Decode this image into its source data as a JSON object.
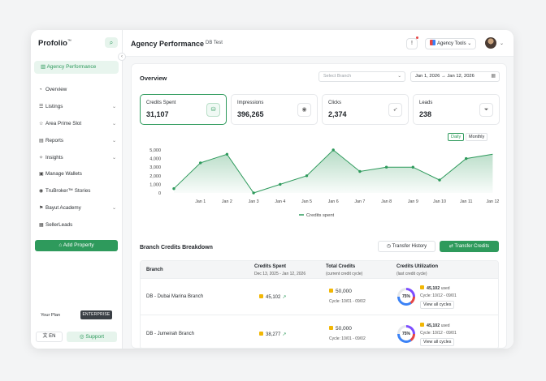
{
  "sidebar": {
    "logo": "Profolio",
    "logo_tm": "™",
    "active_item": "Agency Performance",
    "items": [
      {
        "label": "Overview",
        "icon": "pie-icon",
        "chevron": false
      },
      {
        "label": "Listings",
        "icon": "list-icon",
        "chevron": true
      },
      {
        "label": "Area Prime Slot",
        "icon": "star-icon",
        "chevron": true
      },
      {
        "label": "Reports",
        "icon": "report-icon",
        "chevron": true
      },
      {
        "label": "Insights",
        "icon": "insights-icon",
        "chevron": true
      },
      {
        "label": "Manage Wallets",
        "icon": "wallet-icon",
        "chevron": false
      },
      {
        "label": "TruBroker™ Stories",
        "icon": "stories-icon",
        "chevron": false
      },
      {
        "label": "Bayut Academy",
        "icon": "academy-icon",
        "chevron": true
      },
      {
        "label": "SellerLeads",
        "icon": "leads-icon",
        "chevron": false
      }
    ],
    "add_property": "Add Property",
    "plan_label": "Your Plan",
    "plan_badge": "ENTERPRISE",
    "lang": "EN",
    "support": "Support"
  },
  "header": {
    "title": "Agency Performance",
    "subtitle": "DB Test",
    "tools_label": "Agency Tools"
  },
  "overview": {
    "title": "Overview",
    "branch_placeholder": "Select Branch",
    "date_from": "Jan 1, 2026",
    "date_sep": "→",
    "date_to": "Jan 12, 2026",
    "kpis": [
      {
        "label": "Credits Spent",
        "value": "31,107",
        "icon": "coins-icon"
      },
      {
        "label": "Impressions",
        "value": "396,265",
        "icon": "eye-icon"
      },
      {
        "label": "Clicks",
        "value": "2,374",
        "icon": "cursor-icon"
      },
      {
        "label": "Leads",
        "value": "238",
        "icon": "funnel-icon"
      }
    ],
    "toggle_daily": "Daily",
    "toggle_monthly": "Monthly"
  },
  "chart_data": {
    "type": "area",
    "categories": [
      "Jan 1",
      "Jan 2",
      "Jan 3",
      "Jan 4",
      "Jan 5",
      "Jan 6",
      "Jan 7",
      "Jan 8",
      "Jan 9",
      "Jan 10",
      "Jan 11",
      "Jan 12"
    ],
    "series": [
      {
        "name": "Credits spent",
        "values": [
          500,
          3500,
          4500,
          0,
          1000,
          2000,
          5000,
          2500,
          3000,
          3000,
          1500,
          4000,
          4500
        ]
      }
    ],
    "yticks": [
      "5,000",
      "4,000",
      "3,000",
      "2,000",
      "1,000",
      "0"
    ],
    "ylim": [
      0,
      5000
    ],
    "color": "#2e9a5c"
  },
  "breakdown": {
    "title": "Branch Credits Breakdown",
    "transfer_history": "Transfer History",
    "transfer_credits": "Transfer Credits",
    "columns": {
      "branch": "Branch",
      "credits_spent": "Credits Spent",
      "credits_spent_sub": "Dec 13, 2025 - Jan 12, 2026",
      "total_credits": "Total Credits",
      "total_credits_sub": "(current credit cycle)",
      "utilization": "Credits Utilization",
      "utilization_sub": "(last credit cycle)"
    },
    "rows": [
      {
        "branch": "DB - Dubai Marina Branch",
        "spent": "45,102",
        "total": "50,000",
        "cycle": "Cycle: 10/01 - 09/02",
        "pct": "75%",
        "used": "45,102",
        "used_label": "used",
        "util_cycle": "Cycle: 10/12 - 09/01",
        "view": "View all cycles"
      },
      {
        "branch": "DB - Jumeirah Branch",
        "spent": "38,277",
        "total": "50,000",
        "cycle": "Cycle: 10/01 - 09/02",
        "pct": "75%",
        "used": "45,102",
        "used_label": "used",
        "util_cycle": "Cycle: 10/12 - 09/01",
        "view": "View all cycles"
      }
    ]
  }
}
